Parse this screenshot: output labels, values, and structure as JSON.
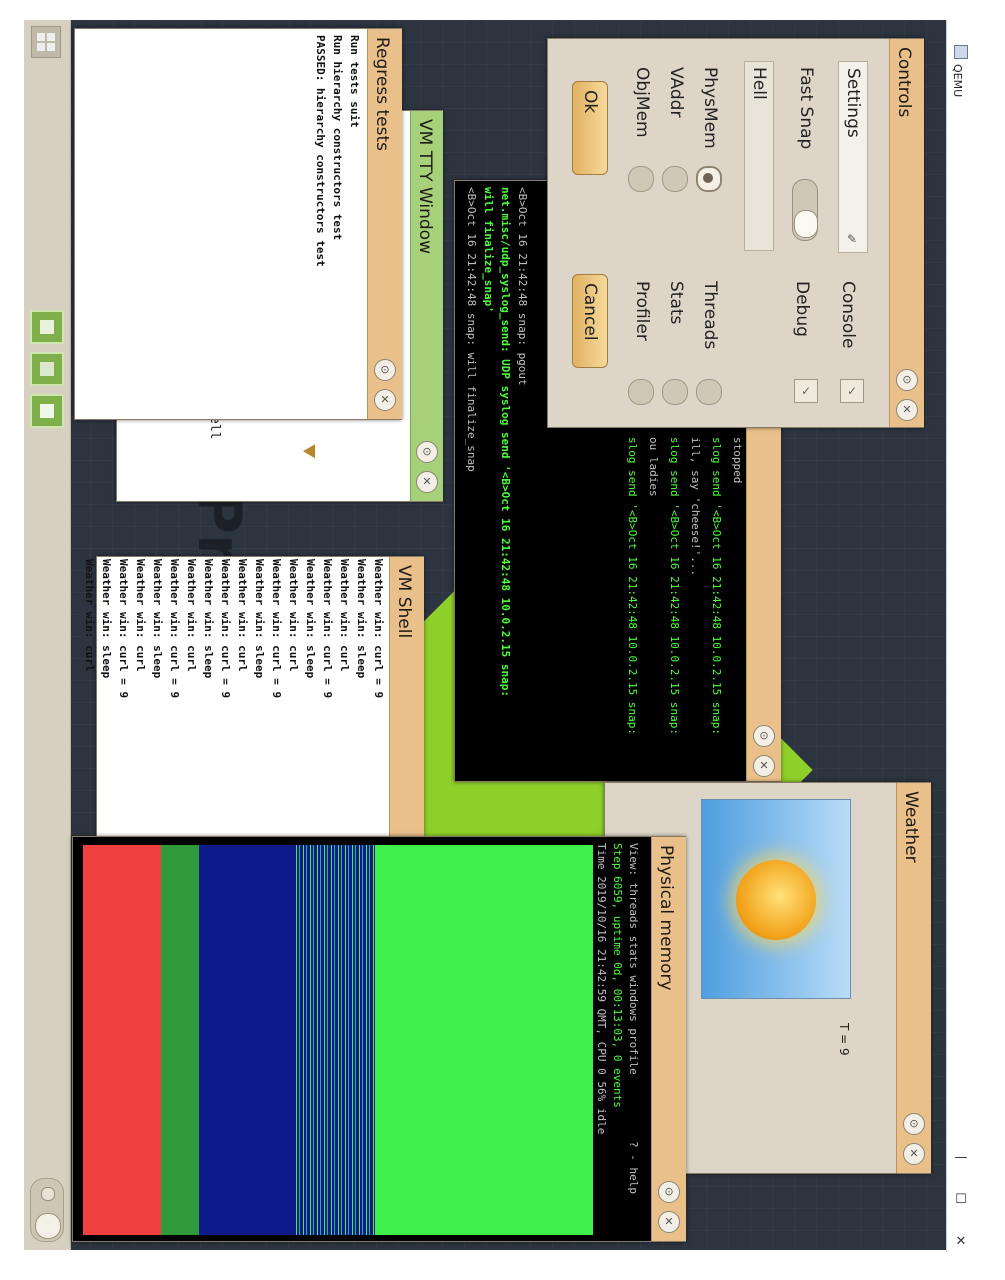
{
  "host": {
    "title": "QEMU",
    "buttons": {
      "minimize": "—",
      "maximize": "☐",
      "close": "✕"
    }
  },
  "windows": {
    "controls": {
      "title": "Controls",
      "settings_label": "Settings",
      "fast_snap_label": "Fast Snap",
      "text_field_value": "Hell",
      "checks_left": [
        "PhysMem",
        "VAddr",
        "ObjMem"
      ],
      "checks_right": [
        "Threads",
        "Stats",
        "Profiler"
      ],
      "console_label": "Console",
      "debug_label": "Debug",
      "ok_label": "Ok",
      "cancel_label": "Cancel"
    },
    "regress": {
      "title": "Regress tests",
      "lines": [
        "Run tests suit",
        "Run hierarchy constructors test",
        "PASSED: hierarchy constructors test"
      ]
    },
    "tty": {
      "title": "VM TTY Window",
      "fragment": "ell"
    },
    "terminal": {
      "lines": [
        "<B>Oct 16 21:42:48 snap: pgout",
        "net.misc/udp_syslog_send: UDP syslog send '<B>Oct 16 21:42:48 10.0.2.15 snap:",
        "will finalize_snap'",
        "<B>Oct 16 21:42:48 snap: will finalize_snap"
      ],
      "right_lines": [
        "stopped",
        "slog send '<B>Oct 16 21:42:48 10.0.2.15 snap:",
        "ill, say 'cheese!'...",
        "slog send '<B>Oct 16 21:42:48 10.0.2.15 snap:",
        "ou ladies",
        "slog send '<B>Oct 16 21:42:48 10.0.2.15 snap:"
      ]
    },
    "shell": {
      "title": "VM Shell",
      "lines": [
        "Weather win: curl = 9",
        "Weather win: sleep",
        "Weather win: curl",
        "Weather win: curl = 9",
        "Weather win: sleep",
        "Weather win: curl",
        "Weather win: curl = 9",
        "Weather win: sleep",
        "Weather win: curl",
        "Weather win: curl = 9",
        "Weather win: sleep",
        "Weather win: curl",
        "Weather win: curl = 9",
        "Weather win: sleep",
        "Weather win: curl",
        "Weather win: curl = 9",
        "Weather win: sleep",
        "Weather win: curl"
      ]
    },
    "weather": {
      "title": "Weather",
      "temp": "T = 9"
    },
    "physmem": {
      "title": "Physical memory",
      "info": [
        "View: threads stats windows profile          ? - help",
        "Step 6059, uptime 0d, 00:13:03, 0 events",
        "Time 2019/10/16 21:42:59 QMT, CPU 0 56% idle"
      ]
    }
  },
  "colors": {
    "desktop": "#2c3440",
    "title_orange": "#e9c089",
    "title_green": "#a6d07a",
    "terminal_bg": "#000000",
    "terminal_green": "#4cff3a",
    "mem_red": "#f04040",
    "mem_green": "#3ff04a",
    "mem_blue": "#0c1a8a"
  },
  "icons": [
    "start-menu-icon",
    "app-icon-monitor",
    "app-icon-list",
    "app-icon-chart",
    "sun-icon",
    "wrench-icon"
  ]
}
